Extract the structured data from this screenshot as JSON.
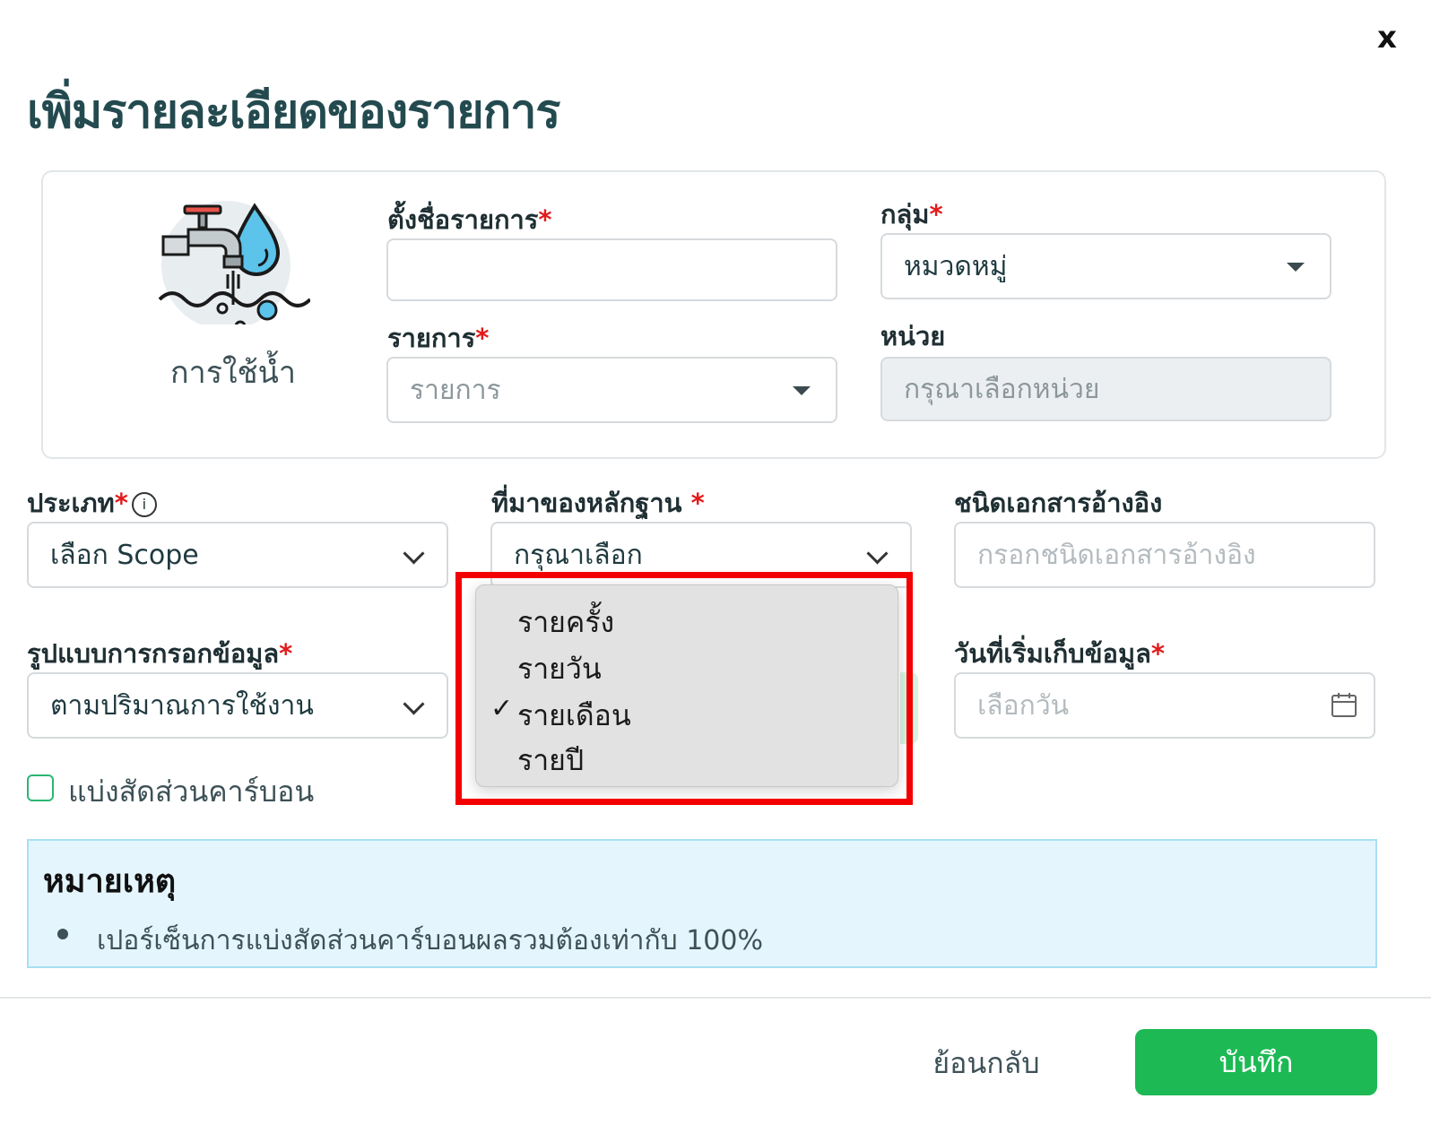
{
  "dialog": {
    "close_label": "x",
    "title": "เพิ่มรายละเอียดของรายการ"
  },
  "item_card": {
    "icon": "water-tap-icon",
    "icon_caption": "การใช้น้ำ",
    "name_label": "ตั้งชื่อรายการ",
    "name_value": "",
    "group_label": "กลุ่ม",
    "group_value": "หมวดหมู่",
    "item_label": "รายการ",
    "item_placeholder": "รายการ",
    "unit_label": "หน่วย",
    "unit_placeholder": "กรุณาเลือกหน่วย"
  },
  "form": {
    "type_label": "ประเภท",
    "type_value": "เลือก Scope",
    "evidence_label": "ที่มาของหลักฐาน",
    "evidence_value": "กรุณาเลือก",
    "doc_type_label": "ชนิดเอกสารอ้างอิง",
    "doc_type_placeholder": "กรอกชนิดเอกสารอ้างอิง",
    "input_mode_label": "รูปแบบการกรอกข้อมูล",
    "input_mode_value": "ตามปริมาณการใช้งาน",
    "start_date_label": "วันที่เริ่มเก็บข้อมูล",
    "start_date_placeholder": "เลือกวัน",
    "carbon_split_label": "แบ่งสัดส่วนคาร์บอน"
  },
  "frequency_dropdown": {
    "options": [
      "รายครั้ง",
      "รายวัน",
      "รายเดือน",
      "รายปี"
    ],
    "selected": "รายเดือน",
    "check_mark": "✓"
  },
  "note": {
    "title": "หมายเหตุ",
    "items": [
      "เปอร์เซ็นการแบ่งสัดส่วนคาร์บอนผลรวมต้องเท่ากับ 100%"
    ]
  },
  "footer": {
    "back_label": "ย้อนกลับ",
    "save_label": "บันทึก"
  },
  "colors": {
    "primary_green": "#1db954",
    "title_teal": "#234a4f",
    "required_red": "#e31b1b",
    "highlight_red": "#f30000",
    "note_bg": "#e5f5fd"
  }
}
